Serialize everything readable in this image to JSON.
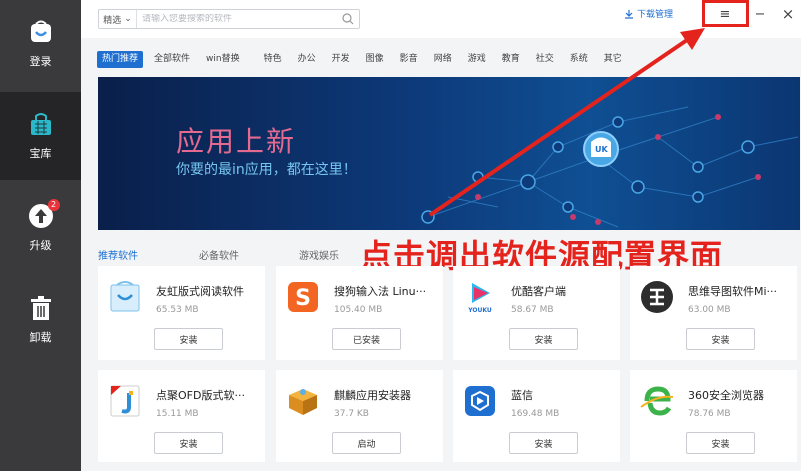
{
  "sidebar": {
    "items": [
      {
        "label": "登录",
        "icon": "store-bag-icon"
      },
      {
        "label": "宝库",
        "icon": "shopping-basket-icon"
      },
      {
        "label": "升级",
        "icon": "upgrade-arrow-icon",
        "badge": "2"
      },
      {
        "label": "卸载",
        "icon": "trash-icon"
      }
    ]
  },
  "topbar": {
    "search_select": "精选",
    "search_placeholder": "请输入您要搜索的软件",
    "download_manager": "下载管理",
    "menu_glyph": "≡",
    "minimize_glyph": "−",
    "close_glyph": "×"
  },
  "categories": [
    "热门推荐",
    "全部软件",
    "win替换",
    "特色",
    "办公",
    "开发",
    "图像",
    "影音",
    "网络",
    "游戏",
    "教育",
    "社交",
    "系统",
    "其它"
  ],
  "banner": {
    "title": "应用上新",
    "subtitle": "你要的最in应用，都在这里！",
    "logo_text": "UK"
  },
  "sections": [
    "推荐软件",
    "必备软件",
    "游戏娱乐"
  ],
  "annotation": "点击调出软件源配置界面",
  "apps": [
    {
      "name": "友虹版式阅读软件",
      "size": "65.53 MB",
      "action": "安装",
      "icon": "reader-bag-icon"
    },
    {
      "name": "搜狗输入法 Linu···",
      "size": "105.40 MB",
      "action": "已安装",
      "icon": "sogou-icon"
    },
    {
      "name": "优酷客户端",
      "size": "58.67 MB",
      "action": "安装",
      "icon": "youku-icon"
    },
    {
      "name": "思维导图软件Mi···",
      "size": "63.00 MB",
      "action": "安装",
      "icon": "mindmap-icon"
    },
    {
      "name": "点聚OFD版式软···",
      "size": "15.11 MB",
      "action": "安装",
      "icon": "ofd-icon"
    },
    {
      "name": "麒麟应用安装器",
      "size": "37.7 KB",
      "action": "启动",
      "icon": "package-box-icon"
    },
    {
      "name": "蓝信",
      "size": "169.48 MB",
      "action": "安装",
      "icon": "lanxin-icon"
    },
    {
      "name": "360安全浏览器",
      "size": "78.76 MB",
      "action": "安装",
      "icon": "browser-360-icon"
    }
  ],
  "colors": {
    "accent": "#1f6fd1",
    "sidebar": "#3a3a3c",
    "annotation_red": "#e5231d"
  }
}
